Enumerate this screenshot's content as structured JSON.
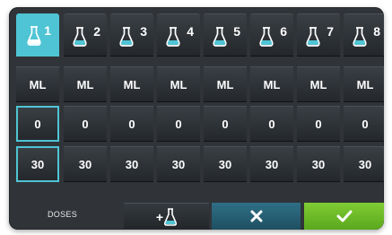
{
  "tabs": [
    {
      "number": "1",
      "unit": "ML",
      "dose": "0",
      "time": "30",
      "active": true
    },
    {
      "number": "2",
      "unit": "ML",
      "dose": "0",
      "time": "30",
      "active": false
    },
    {
      "number": "3",
      "unit": "ML",
      "dose": "0",
      "time": "30",
      "active": false
    },
    {
      "number": "4",
      "unit": "ML",
      "dose": "0",
      "time": "30",
      "active": false
    },
    {
      "number": "5",
      "unit": "ML",
      "dose": "0",
      "time": "30",
      "active": false
    },
    {
      "number": "6",
      "unit": "ML",
      "dose": "0",
      "time": "30",
      "active": false
    },
    {
      "number": "7",
      "unit": "ML",
      "dose": "0",
      "time": "30",
      "active": false
    },
    {
      "number": "8",
      "unit": "ML",
      "dose": "0",
      "time": "30",
      "active": false
    }
  ],
  "footer": {
    "doses_label": "DOSES",
    "add_button": {
      "label": "+",
      "icon": "flask-icon"
    },
    "cancel_button": {
      "icon": "close-icon"
    },
    "confirm_button": {
      "icon": "check-icon"
    }
  },
  "colors": {
    "accent": "#4fc4d4",
    "panel": "#303438",
    "confirm": "#6cbb28",
    "cancel": "#28627a"
  }
}
